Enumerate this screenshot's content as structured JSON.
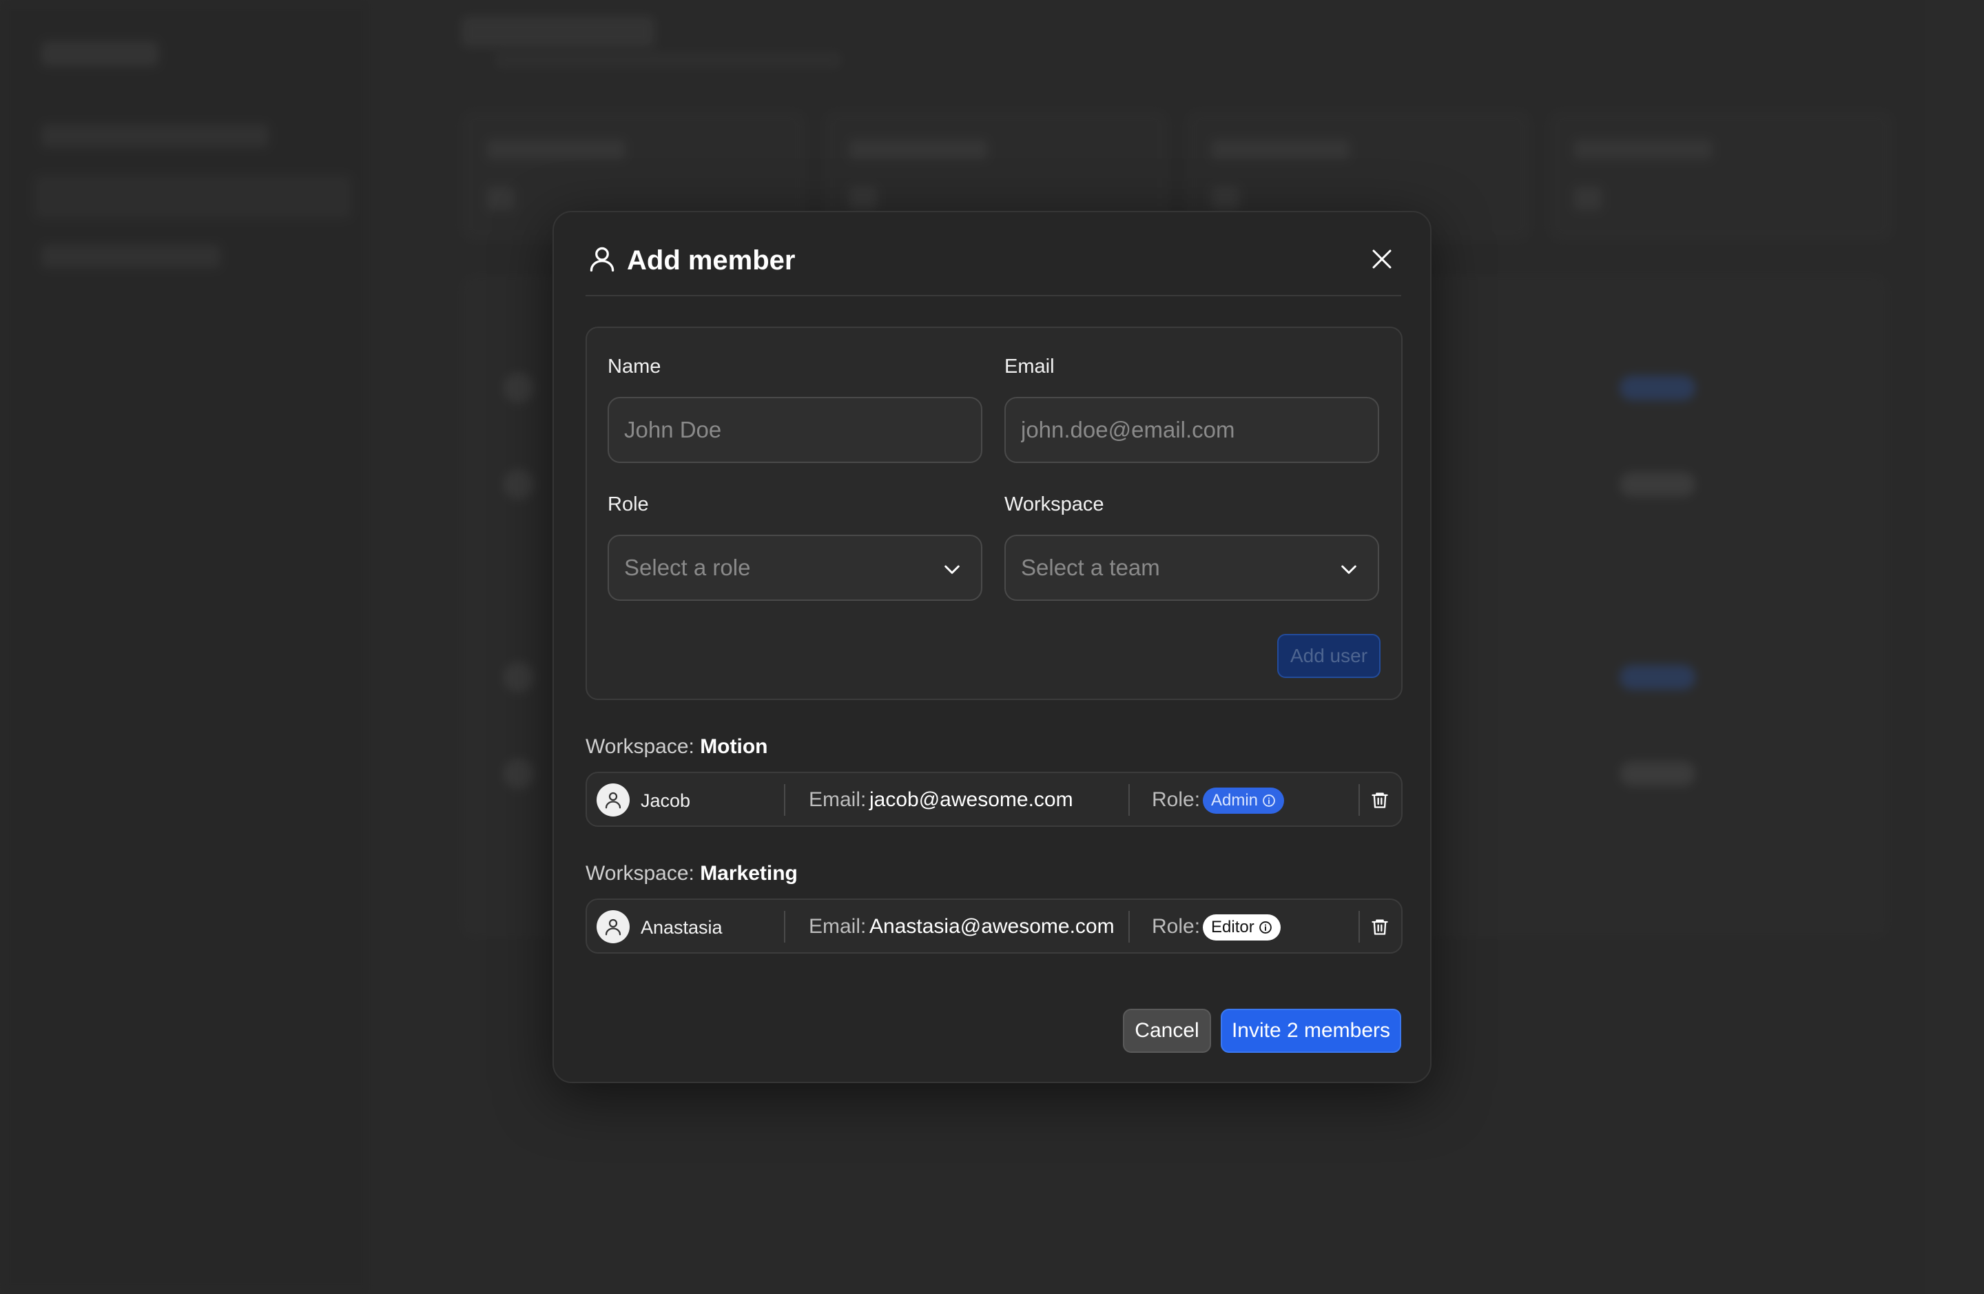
{
  "modal": {
    "title": "Add member",
    "header_icon": "user-icon",
    "close_icon": "close-icon"
  },
  "form": {
    "name": {
      "label": "Name",
      "placeholder": "John Doe",
      "value": ""
    },
    "email": {
      "label": "Email",
      "placeholder": "john.doe@email.com",
      "value": ""
    },
    "role": {
      "label": "Role",
      "placeholder": "Select a role"
    },
    "workspace": {
      "label": "Workspace",
      "placeholder": "Select a team"
    },
    "add_user_label": "Add user"
  },
  "members": [
    {
      "workspace_prefix": "Workspace:",
      "workspace": "Motion",
      "name": "Jacob",
      "email_label": "Email:",
      "email": "jacob@awesome.com",
      "role_label": "Role:",
      "role": "Admin",
      "role_color": "#2f66e6"
    },
    {
      "workspace_prefix": "Workspace:",
      "workspace": "Marketing",
      "name": "Anastasia",
      "email_label": "Email:",
      "email": "Anastasia@awesome.com",
      "role_label": "Role:",
      "role": "Editor",
      "role_color": "#ffffff"
    }
  ],
  "footer": {
    "cancel_label": "Cancel",
    "invite_label": "Invite 2 members"
  },
  "colors": {
    "background": "#333333",
    "modal": "#262626",
    "accent": "#2563eb"
  }
}
